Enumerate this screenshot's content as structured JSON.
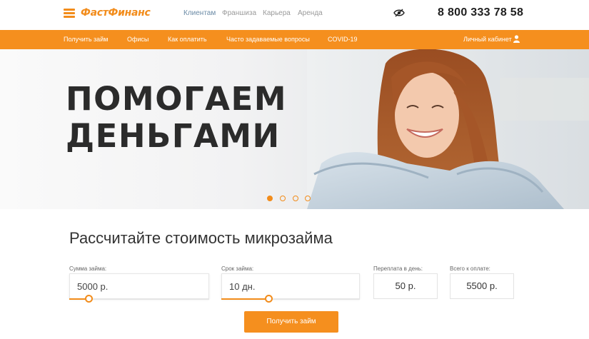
{
  "header": {
    "logo": "ФастФинанс",
    "nav": [
      {
        "label": "Клиентам",
        "active": true
      },
      {
        "label": "Франшиза",
        "active": false
      },
      {
        "label": "Карьера",
        "active": false
      },
      {
        "label": "Аренда",
        "active": false
      }
    ],
    "phone": "8 800 333 78 58",
    "icons": {
      "menu": "hamburger-icon",
      "accessibility": "eye-slash-icon"
    }
  },
  "subnav": {
    "items": [
      {
        "label": "Получить займ"
      },
      {
        "label": "Офисы"
      },
      {
        "label": "Как оплатить"
      },
      {
        "label": "Часто задаваемые вопросы"
      },
      {
        "label": "COVID-19"
      }
    ],
    "cabinet_label": "Личный кабинет",
    "cabinet_icon": "user-icon"
  },
  "hero": {
    "line1": "ПОМОГАЕМ",
    "line2": "ДЕНЬГАМИ",
    "slides_count": 4,
    "active_slide": 1
  },
  "calculator": {
    "title": "Рассчитайте стоимость микрозайма",
    "amount": {
      "label": "Сумма займа:",
      "value": "5000 р.",
      "slider_level": 0.14
    },
    "term": {
      "label": "Срок займа:",
      "value": "10 дн.",
      "slider_level": 0.34
    },
    "overpay": {
      "label": "Переплата в день:",
      "value": "50 р."
    },
    "total": {
      "label": "Всего к оплате:",
      "value": "5500 р."
    },
    "submit_label": "Получить займ"
  },
  "colors": {
    "accent": "#f58f1e",
    "text": "#333333",
    "nav_active": "#6a8aa5"
  }
}
